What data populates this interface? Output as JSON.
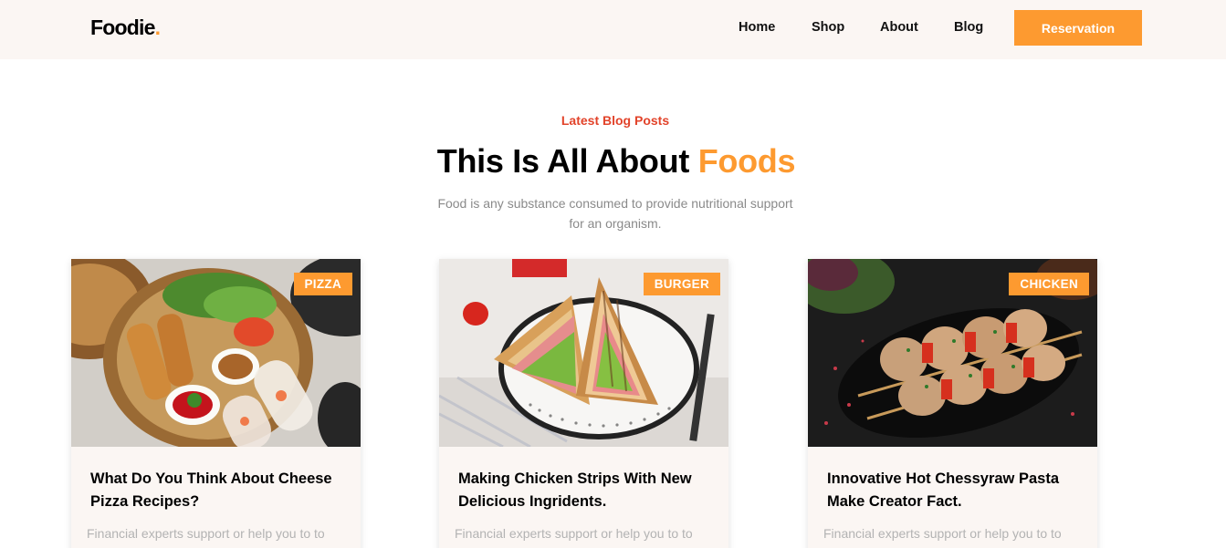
{
  "brand": {
    "name": "Foodie",
    "dot": "."
  },
  "nav": {
    "items": [
      "Home",
      "Shop",
      "About",
      "Blog"
    ],
    "cta": "Reservation"
  },
  "section": {
    "eyebrow": "Latest Blog Posts",
    "headline_main": "This Is All About",
    "headline_accent": "Foods",
    "subtitle": "Food is any substance consumed to provide nutritional support for an organism."
  },
  "cards": [
    {
      "category": "PIZZA",
      "title": "What Do You Think About Cheese Pizza Recipes?",
      "excerpt": "Financial experts support or help you to to"
    },
    {
      "category": "BURGER",
      "title": "Making Chicken Strips With New Delicious Ingridents.",
      "excerpt": "Financial experts support or help you to to"
    },
    {
      "category": "CHICKEN",
      "title": "Innovative Hot Chessyraw Pasta Make Creator Fact.",
      "excerpt": "Financial experts support or help you to to"
    }
  ],
  "colors": {
    "accent": "#fd9a30",
    "eyebrow": "#e2432a",
    "header_bg": "#fbf6f3"
  }
}
